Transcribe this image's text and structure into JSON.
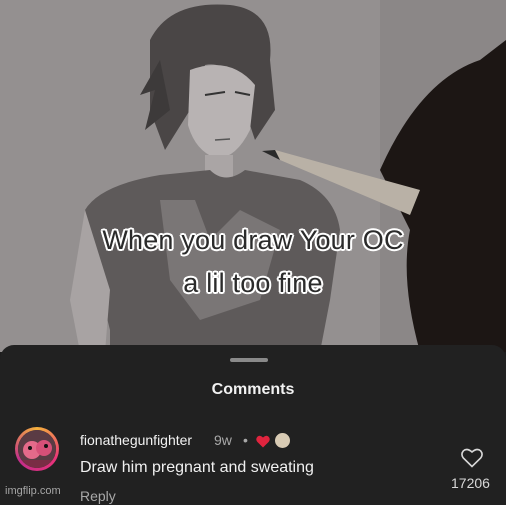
{
  "video": {
    "caption_line1": "When you draw Your OC",
    "caption_line2": "a lil too fine"
  },
  "comments_sheet": {
    "title": "Comments",
    "comment": {
      "username": "fionathegunfighter",
      "time": "9w",
      "separator": "•",
      "text": "Draw him pregnant and sweating",
      "reply_label": "Reply",
      "like_count": "17206",
      "liked_by_creator": true
    }
  },
  "watermark": "imgflip.com",
  "colors": {
    "sheet_bg": "#212121",
    "heart_red": "#e0243e",
    "avatar_ring": "#e8327a"
  }
}
